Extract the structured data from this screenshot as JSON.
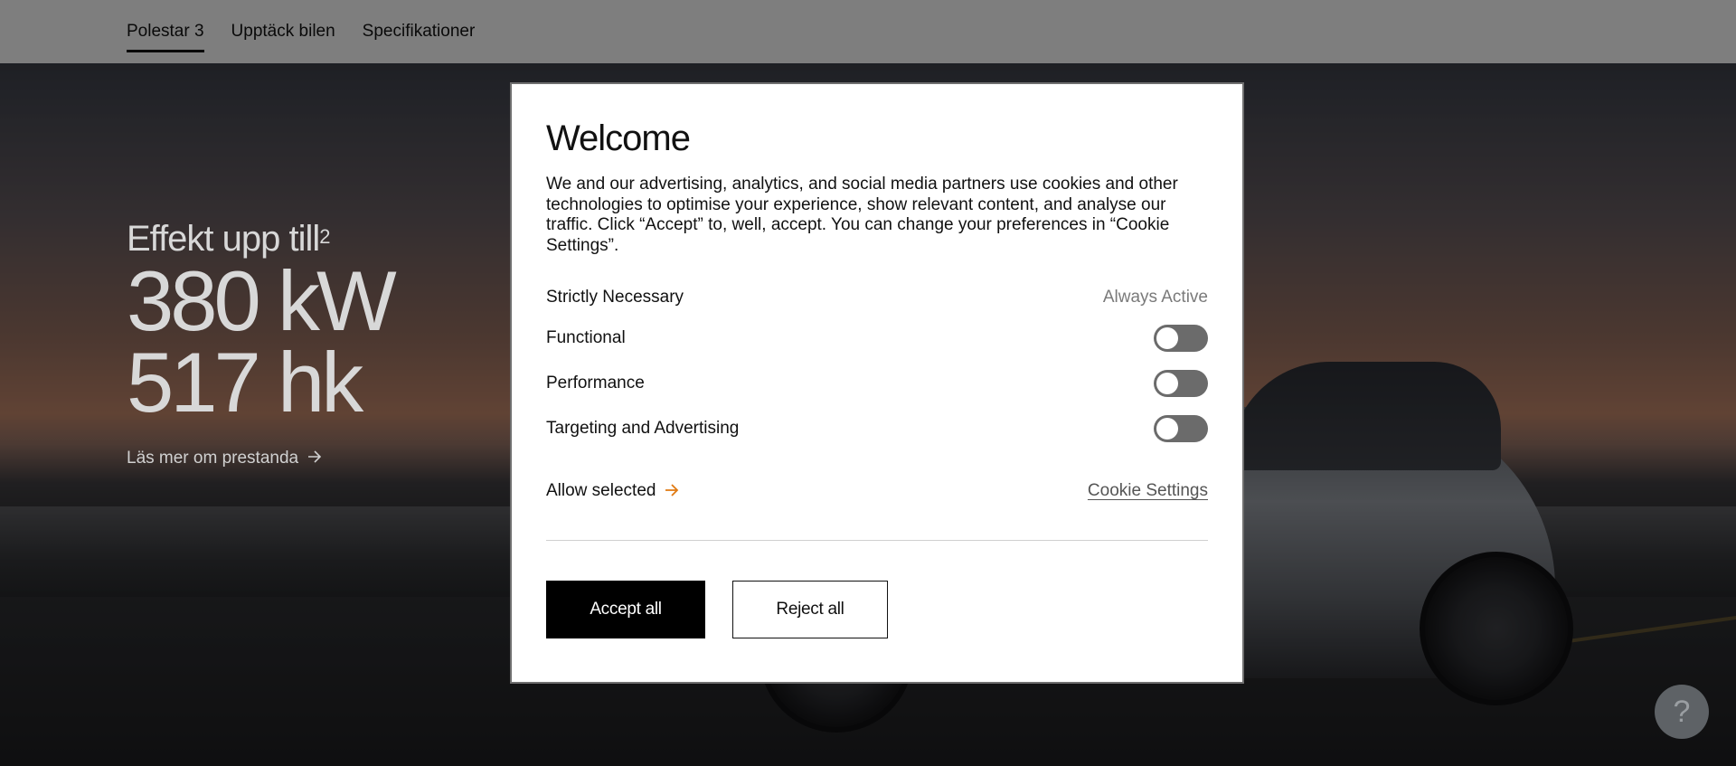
{
  "nav": {
    "items": [
      {
        "label": "Polestar 3",
        "active": true
      },
      {
        "label": "Upptäck bilen",
        "active": false
      },
      {
        "label": "Specifikationer",
        "active": false
      }
    ]
  },
  "hero": {
    "eyebrow": "Effekt upp till",
    "eyebrow_sup": "2",
    "line1": "380 kW",
    "line2": "517 hk",
    "link_label": "Läs mer om prestanda",
    "link_icon": "arrow-right-icon"
  },
  "help": {
    "label": "?"
  },
  "modal": {
    "title": "Welcome",
    "text": "We and our advertising, analytics, and social media partners use cookies and other technologies to optimise your experience, show relevant content, and analyse our traffic. Click “Accept” to, well, accept. You can change your preferences in “Cookie Settings”.",
    "categories": [
      {
        "label": "Strictly Necessary",
        "status": "Always Active"
      },
      {
        "label": "Functional",
        "enabled": false
      },
      {
        "label": "Performance",
        "enabled": false
      },
      {
        "label": "Targeting and Advertising",
        "enabled": false
      }
    ],
    "allow_selected": "Allow selected",
    "cookie_settings": "Cookie Settings",
    "accept_all": "Accept all",
    "reject_all": "Reject all",
    "accent_color": "#e07a12"
  }
}
